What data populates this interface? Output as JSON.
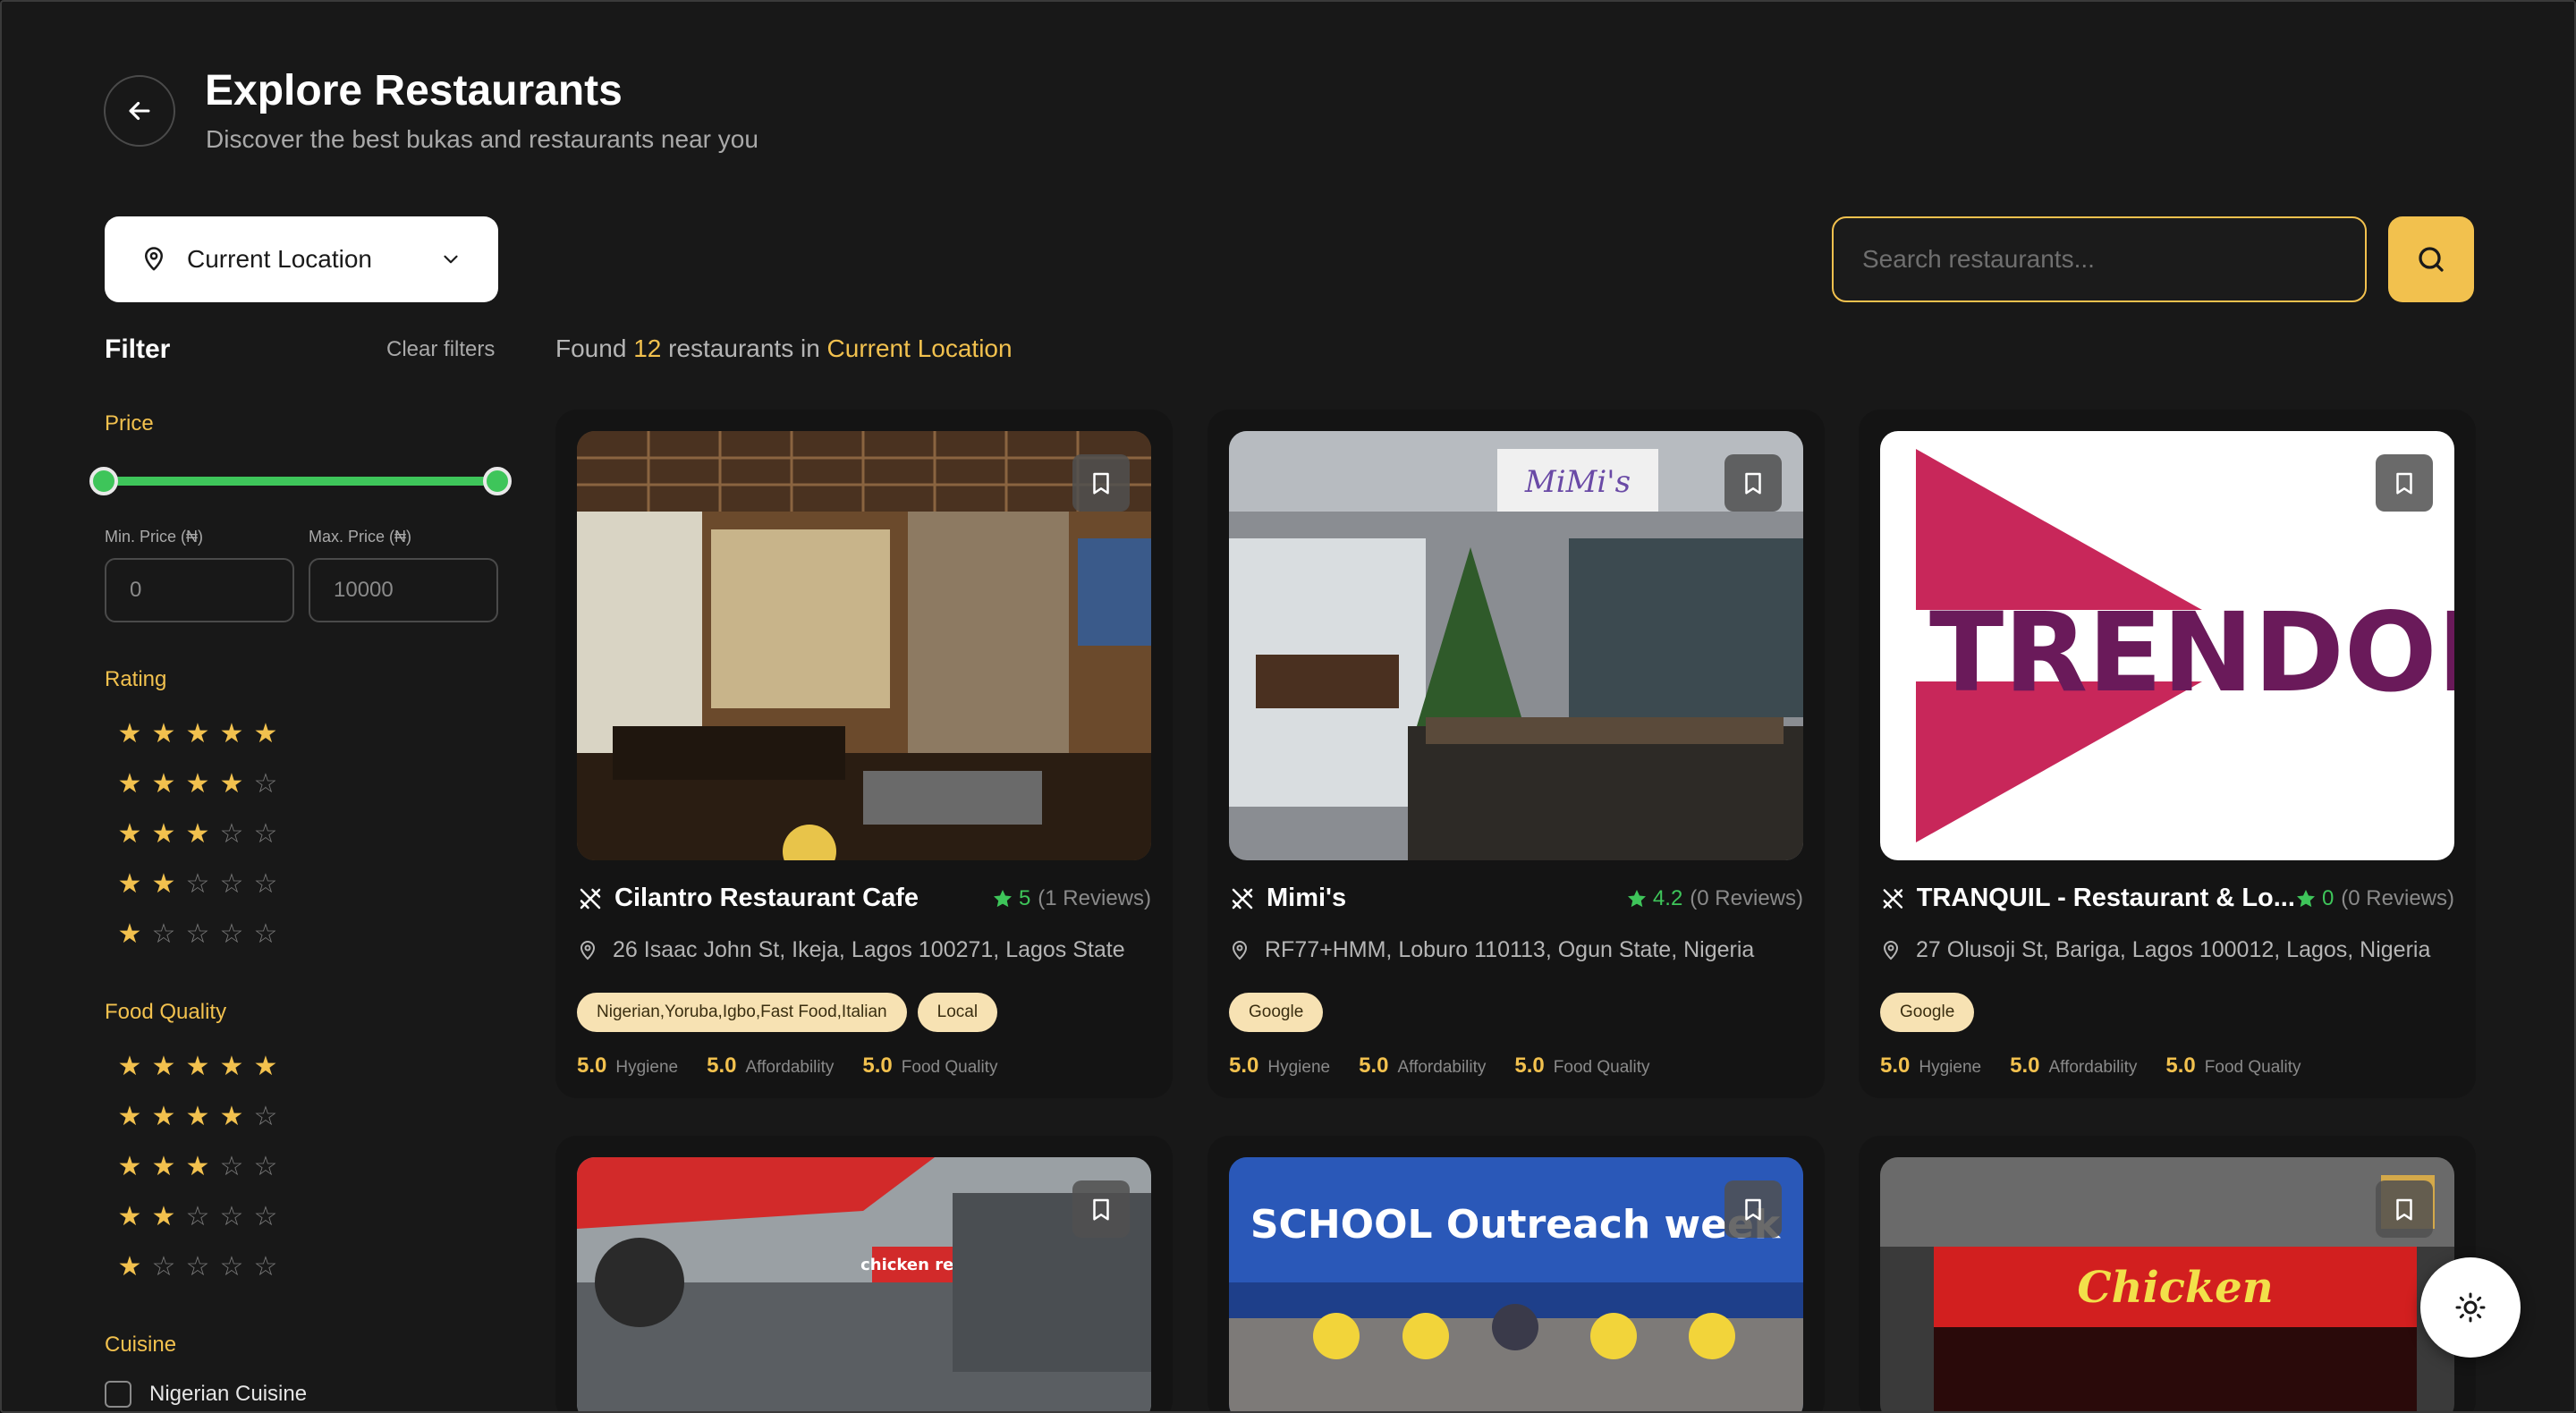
{
  "header": {
    "title": "Explore Restaurants",
    "subtitle": "Discover the best bukas and restaurants near you"
  },
  "location": {
    "label": "Current Location"
  },
  "search": {
    "placeholder": "Search restaurants..."
  },
  "filter": {
    "title": "Filter",
    "clear_label": "Clear filters",
    "price": {
      "title": "Price",
      "min_label": "Min. Price (₦)",
      "max_label": "Max. Price (₦)",
      "min_value": "0",
      "max_value": "10000"
    },
    "rating": {
      "title": "Rating",
      "levels": [
        5,
        4,
        3,
        2,
        1
      ]
    },
    "food_quality": {
      "title": "Food Quality",
      "levels": [
        5,
        4,
        3,
        2,
        1
      ]
    },
    "cuisine": {
      "title": "Cuisine",
      "items": [
        "Nigerian Cuisine"
      ]
    }
  },
  "results": {
    "prefix": "Found",
    "count": "12",
    "middle": "restaurants in",
    "location": "Current Location"
  },
  "restaurants": [
    {
      "name": "Cilantro Restaurant Cafe",
      "rating": "5",
      "reviews": "(1 Reviews)",
      "address": "26 Isaac John St, Ikeja, Lagos 100271, Lagos State",
      "tags": [
        "Nigerian,Yoruba,Igbo,Fast Food,Italian",
        "Local"
      ],
      "hygiene": "5.0",
      "affordability": "5.0",
      "food_quality": "5.0"
    },
    {
      "name": "Mimi's",
      "rating": "4.2",
      "reviews": "(0 Reviews)",
      "address": "RF77+HMM, Loburo 110113, Ogun State, Nigeria",
      "tags": [
        "Google"
      ],
      "hygiene": "5.0",
      "affordability": "5.0",
      "food_quality": "5.0"
    },
    {
      "name": "TRANQUIL - Restaurant & Lo...",
      "rating": "0",
      "reviews": "(0 Reviews)",
      "address": "27 Olusoji St, Bariga, Lagos 100012, Lagos, Nigeria",
      "tags": [
        "Google"
      ],
      "hygiene": "5.0",
      "affordability": "5.0",
      "food_quality": "5.0",
      "logo_text": "TRENDOP"
    }
  ],
  "mini_image_text": {
    "mimis_sign": "MiMi's",
    "chicken_sign": "chicken republic",
    "school_sign": "SCHOOL Outreach week",
    "store_sign": "Chicken"
  },
  "metric_labels": {
    "hygiene": "Hygiene",
    "affordability": "Affordability",
    "food_quality": "Food Quality"
  },
  "colors": {
    "accent": "#f2c14e",
    "green": "#3ec55a",
    "background": "#181818",
    "tag_bg": "#f7e2b3"
  },
  "icons": [
    "arrow-left-icon",
    "map-pin-icon",
    "chevron-down-icon",
    "search-icon",
    "bookmark-icon",
    "utensils-icon",
    "star-icon",
    "sun-icon"
  ]
}
